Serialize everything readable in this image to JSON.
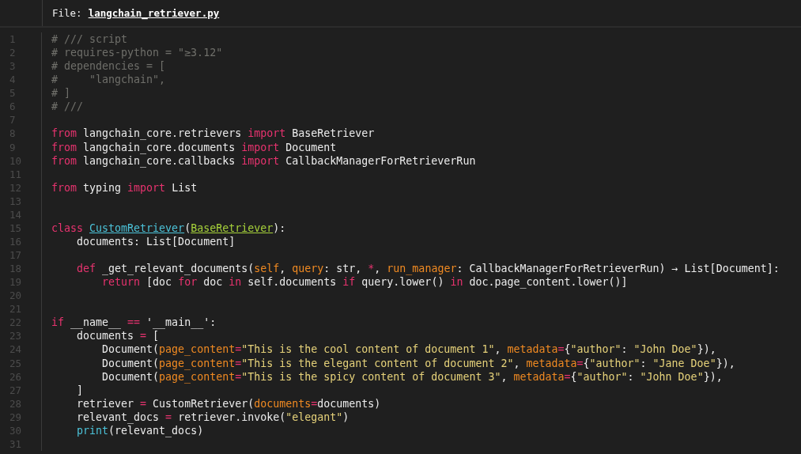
{
  "header": {
    "label": "File:",
    "filename": "langchain_retriever.py"
  },
  "lines": [
    {
      "number": "1",
      "tokens": [
        {
          "kind": "cm",
          "text": "# /// script"
        }
      ]
    },
    {
      "number": "2",
      "tokens": [
        {
          "kind": "cm",
          "text": "# requires-python = \"≥3.12\""
        }
      ]
    },
    {
      "number": "3",
      "tokens": [
        {
          "kind": "cm",
          "text": "# dependencies = ["
        }
      ]
    },
    {
      "number": "4",
      "tokens": [
        {
          "kind": "cm",
          "text": "#     \"langchain\","
        }
      ]
    },
    {
      "number": "5",
      "tokens": [
        {
          "kind": "cm",
          "text": "# ]"
        }
      ]
    },
    {
      "number": "6",
      "tokens": [
        {
          "kind": "cm",
          "text": "# ///"
        }
      ]
    },
    {
      "number": "7"
    },
    {
      "number": "8",
      "tokens": [
        {
          "kind": "kw",
          "text": "from"
        },
        {
          "kind": "tx",
          "text": " langchain_core.retrievers "
        },
        {
          "kind": "kw",
          "text": "import"
        },
        {
          "kind": "tx",
          "text": " BaseRetriever"
        }
      ]
    },
    {
      "number": "9",
      "tokens": [
        {
          "kind": "kw",
          "text": "from"
        },
        {
          "kind": "tx",
          "text": " langchain_core.documents "
        },
        {
          "kind": "kw",
          "text": "import"
        },
        {
          "kind": "tx",
          "text": " Document"
        }
      ]
    },
    {
      "number": "10",
      "tokens": [
        {
          "kind": "kw",
          "text": "from"
        },
        {
          "kind": "tx",
          "text": " langchain_core.callbacks "
        },
        {
          "kind": "kw",
          "text": "import"
        },
        {
          "kind": "tx",
          "text": " CallbackManagerForRetrieverRun"
        }
      ]
    },
    {
      "number": "11"
    },
    {
      "number": "12",
      "tokens": [
        {
          "kind": "kw",
          "text": "from"
        },
        {
          "kind": "tx",
          "text": " typing "
        },
        {
          "kind": "kw",
          "text": "import"
        },
        {
          "kind": "tx",
          "text": " List"
        }
      ]
    },
    {
      "number": "13"
    },
    {
      "number": "14"
    },
    {
      "number": "15",
      "tokens": [
        {
          "kind": "kw",
          "text": "class "
        },
        {
          "kind": "cls",
          "text": "CustomRetriever"
        },
        {
          "kind": "tx",
          "text": "("
        },
        {
          "kind": "base",
          "text": "BaseRetriever"
        },
        {
          "kind": "tx",
          "text": "):"
        }
      ]
    },
    {
      "number": "16",
      "tokens": [
        {
          "kind": "tx",
          "text": "    documents: List[Document]"
        }
      ]
    },
    {
      "number": "17"
    },
    {
      "number": "18",
      "tokens": [
        {
          "kind": "kw",
          "text": "    def"
        },
        {
          "kind": "tx",
          "text": " _get_relevant_documents("
        },
        {
          "kind": "pa",
          "text": "self"
        },
        {
          "kind": "tx",
          "text": ", "
        },
        {
          "kind": "pa",
          "text": "query"
        },
        {
          "kind": "tx",
          "text": ": str, "
        },
        {
          "kind": "op",
          "text": "*"
        },
        {
          "kind": "tx",
          "text": ", "
        },
        {
          "kind": "pa",
          "text": "run_manager"
        },
        {
          "kind": "tx",
          "text": ": CallbackManagerForRetrieverRun) → List[Document]:"
        }
      ]
    },
    {
      "number": "19",
      "tokens": [
        {
          "kind": "kw",
          "text": "        return"
        },
        {
          "kind": "tx",
          "text": " [doc "
        },
        {
          "kind": "kw",
          "text": "for"
        },
        {
          "kind": "tx",
          "text": " doc "
        },
        {
          "kind": "kw",
          "text": "in"
        },
        {
          "kind": "tx",
          "text": " self.documents "
        },
        {
          "kind": "kw",
          "text": "if"
        },
        {
          "kind": "tx",
          "text": " query.lower() "
        },
        {
          "kind": "kw",
          "text": "in"
        },
        {
          "kind": "tx",
          "text": " doc.page_content.lower()]"
        }
      ]
    },
    {
      "number": "20"
    },
    {
      "number": "21"
    },
    {
      "number": "22",
      "tokens": [
        {
          "kind": "kw",
          "text": "if"
        },
        {
          "kind": "tx",
          "text": " __name__ "
        },
        {
          "kind": "op",
          "text": "=="
        },
        {
          "kind": "tx",
          "text": " '__main__':"
        }
      ]
    },
    {
      "number": "23",
      "tokens": [
        {
          "kind": "tx",
          "text": "    documents "
        },
        {
          "kind": "op",
          "text": "="
        },
        {
          "kind": "tx",
          "text": " ["
        }
      ]
    },
    {
      "number": "24",
      "tokens": [
        {
          "kind": "tx",
          "text": "        Document("
        },
        {
          "kind": "pa",
          "text": "page_content"
        },
        {
          "kind": "op",
          "text": "="
        },
        {
          "kind": "st",
          "text": "\"This is the cool content of document 1\""
        },
        {
          "kind": "tx",
          "text": ", "
        },
        {
          "kind": "pa",
          "text": "metadata"
        },
        {
          "kind": "op",
          "text": "="
        },
        {
          "kind": "tx",
          "text": "{"
        },
        {
          "kind": "st",
          "text": "\"author\""
        },
        {
          "kind": "tx",
          "text": ": "
        },
        {
          "kind": "st",
          "text": "\"John Doe\""
        },
        {
          "kind": "tx",
          "text": "}),"
        }
      ]
    },
    {
      "number": "25",
      "tokens": [
        {
          "kind": "tx",
          "text": "        Document("
        },
        {
          "kind": "pa",
          "text": "page_content"
        },
        {
          "kind": "op",
          "text": "="
        },
        {
          "kind": "st",
          "text": "\"This is the elegant content of document 2\""
        },
        {
          "kind": "tx",
          "text": ", "
        },
        {
          "kind": "pa",
          "text": "metadata"
        },
        {
          "kind": "op",
          "text": "="
        },
        {
          "kind": "tx",
          "text": "{"
        },
        {
          "kind": "st",
          "text": "\"author\""
        },
        {
          "kind": "tx",
          "text": ": "
        },
        {
          "kind": "st",
          "text": "\"Jane Doe\""
        },
        {
          "kind": "tx",
          "text": "}),"
        }
      ]
    },
    {
      "number": "26",
      "tokens": [
        {
          "kind": "tx",
          "text": "        Document("
        },
        {
          "kind": "pa",
          "text": "page_content"
        },
        {
          "kind": "op",
          "text": "="
        },
        {
          "kind": "st",
          "text": "\"This is the spicy content of document 3\""
        },
        {
          "kind": "tx",
          "text": ", "
        },
        {
          "kind": "pa",
          "text": "metadata"
        },
        {
          "kind": "op",
          "text": "="
        },
        {
          "kind": "tx",
          "text": "{"
        },
        {
          "kind": "st",
          "text": "\"author\""
        },
        {
          "kind": "tx",
          "text": ": "
        },
        {
          "kind": "st",
          "text": "\"John Doe\""
        },
        {
          "kind": "tx",
          "text": "}),"
        }
      ]
    },
    {
      "number": "27",
      "tokens": [
        {
          "kind": "tx",
          "text": "    ]"
        }
      ]
    },
    {
      "number": "28",
      "tokens": [
        {
          "kind": "tx",
          "text": "    retriever "
        },
        {
          "kind": "op",
          "text": "="
        },
        {
          "kind": "tx",
          "text": " CustomRetriever("
        },
        {
          "kind": "pa",
          "text": "documents"
        },
        {
          "kind": "op",
          "text": "="
        },
        {
          "kind": "tx",
          "text": "documents)"
        }
      ]
    },
    {
      "number": "29",
      "tokens": [
        {
          "kind": "tx",
          "text": "    relevant_docs "
        },
        {
          "kind": "op",
          "text": "="
        },
        {
          "kind": "tx",
          "text": " retriever.invoke("
        },
        {
          "kind": "st",
          "text": "\"elegant\""
        },
        {
          "kind": "tx",
          "text": ")"
        }
      ]
    },
    {
      "number": "30",
      "tokens": [
        {
          "kind": "bi",
          "text": "    print"
        },
        {
          "kind": "tx",
          "text": "(relevant_docs)"
        }
      ]
    },
    {
      "number": "31"
    }
  ]
}
